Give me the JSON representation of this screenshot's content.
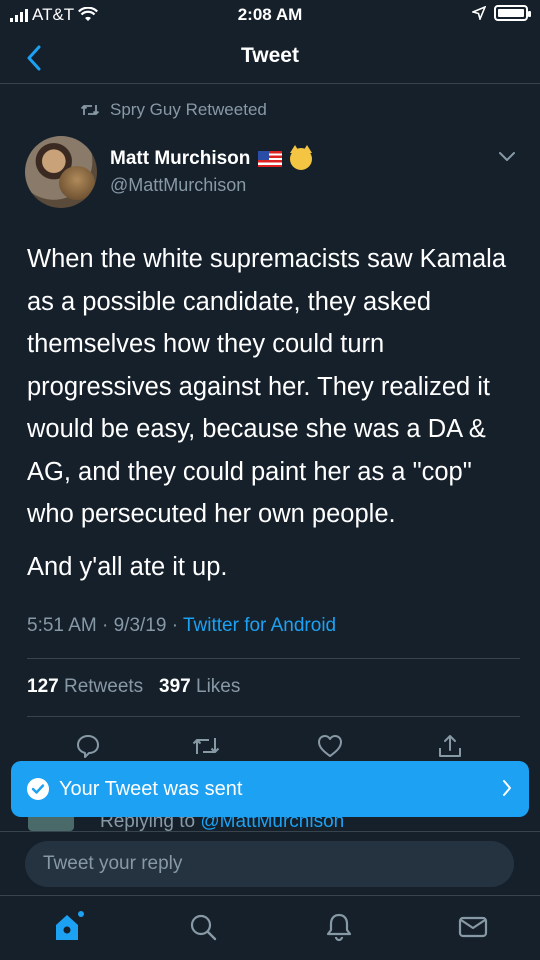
{
  "status_bar": {
    "carrier": "AT&T",
    "time": "2:08 AM"
  },
  "nav": {
    "title": "Tweet"
  },
  "retweet_context": {
    "text": "Spry Guy Retweeted"
  },
  "author": {
    "name": "Matt Murchison",
    "handle": "@MattMurchison"
  },
  "tweet": {
    "paragraph1": "When the white supremacists saw Kamala as a possible candidate, they asked themselves how they could turn progressives against her. They realized it would be easy, because she was a DA & AG, and they could paint her as a \"cop\" who persecuted her own people.",
    "paragraph2": "And y'all ate it up.",
    "time": "5:51 AM",
    "date": "9/3/19",
    "source": "Twitter for Android",
    "separator": " · "
  },
  "stats": {
    "retweets_count": "127",
    "retweets_label": "Retweets",
    "likes_count": "397",
    "likes_label": "Likes"
  },
  "toast": {
    "text": "Your Tweet was sent"
  },
  "replying": {
    "prefix": "Replying to",
    "mention": "@MattMurchison"
  },
  "reply": {
    "placeholder": "Tweet your reply"
  },
  "colors": {
    "background": "#15202b",
    "accent": "#1da1f2",
    "muted": "#8899a6",
    "divider": "#38444d"
  },
  "icons": [
    "back-chevron-icon",
    "retweet-icon",
    "chevron-down-icon",
    "reply-icon",
    "like-icon",
    "share-icon",
    "check-icon",
    "home-icon",
    "search-icon",
    "notifications-icon",
    "messages-icon"
  ]
}
